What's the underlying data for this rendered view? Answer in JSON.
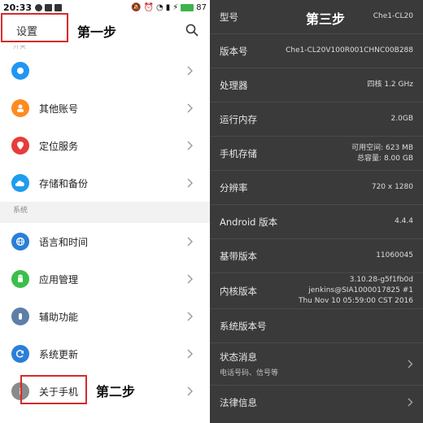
{
  "left": {
    "status": {
      "time": "20:33",
      "battery": "87"
    },
    "header": {
      "title": "设置",
      "step1": "第一步"
    },
    "partial_section": "开关",
    "items_top": [
      {
        "label": ""
      },
      {
        "label": "其他账号"
      },
      {
        "label": "定位服务"
      },
      {
        "label": "存储和备份"
      }
    ],
    "section_system": "系统",
    "items_system": [
      {
        "label": "语言和时间"
      },
      {
        "label": "应用管理"
      },
      {
        "label": "辅助功能"
      },
      {
        "label": "系统更新"
      },
      {
        "label": "关于手机"
      }
    ],
    "step2": "第二步"
  },
  "right": {
    "step3": "第三步",
    "rows": [
      {
        "key": "型号",
        "value": "Che1-CL20"
      },
      {
        "key": "版本号",
        "value": "Che1-CL20V100R001CHNC00B288"
      },
      {
        "key": "处理器",
        "value": "四核 1.2 GHz"
      },
      {
        "key": "运行内存",
        "value": "2.0GB"
      },
      {
        "key": "手机存储",
        "value": "可用空间: 623 MB",
        "value2": "总容量: 8.00 GB"
      },
      {
        "key": "分辨率",
        "value": "720 x 1280"
      },
      {
        "key": "Android 版本",
        "value": "4.4.4"
      },
      {
        "key": "基带版本",
        "value": "11060045"
      },
      {
        "key": "内核版本",
        "value": "3.10.28-g5f1fb0d",
        "value2": "jenkins@SIA1000017825 #1",
        "value3": "Thu Nov 10 05:59:00 CST 2016"
      },
      {
        "key": "系统版本号",
        "value": ""
      },
      {
        "key": "状态消息",
        "sub": "电话号码、信号等"
      },
      {
        "key": "法律信息"
      }
    ]
  },
  "colors": {
    "accent_red": "#d52b2b",
    "dark_panel": "#3a3a3a"
  }
}
